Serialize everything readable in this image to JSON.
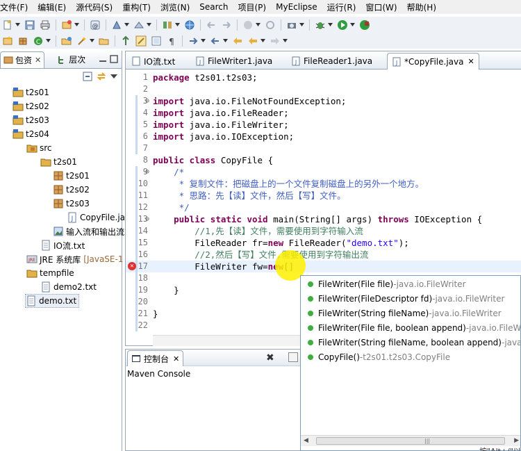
{
  "menu": [
    "文件(F)",
    "编辑(E)",
    "源代码(S)",
    "重构(T)",
    "浏览(N)",
    "Search",
    "项目(P)",
    "MyEclipse",
    "运行(R)",
    "窗口(W)",
    "帮助(H)"
  ],
  "left_panel": {
    "tabs": [
      {
        "label": "包资",
        "close": "✕"
      },
      {
        "label": "层次"
      }
    ],
    "tree": [
      {
        "label": "t2s01",
        "icon": "project-icon"
      },
      {
        "label": "t2s02",
        "icon": "project-icon"
      },
      {
        "label": "t2s03",
        "icon": "project-icon"
      },
      {
        "label": "t2s04",
        "icon": "project-icon"
      },
      {
        "label": "src",
        "icon": "source-folder-icon"
      },
      {
        "label": "t2s01",
        "icon": "package-icon"
      },
      {
        "label": "t2s01",
        "icon": "package-icon"
      },
      {
        "label": "t2s02",
        "icon": "package-icon"
      },
      {
        "label": "t2s03",
        "icon": "package-icon"
      },
      {
        "label": "CopyFile.ja",
        "icon": "java-file-icon"
      },
      {
        "label": "输入流和输出流",
        "icon": "image-file-icon"
      },
      {
        "label": "IO流.txt",
        "icon": "text-file-icon"
      },
      {
        "label": "JRE 系统库",
        "suffix": "[JavaSE-1",
        "icon": "library-icon"
      },
      {
        "label": "tempfile",
        "icon": "folder-icon"
      },
      {
        "label": "demo2.txt",
        "icon": "text-file-icon"
      },
      {
        "label": "demo.txt",
        "icon": "text-file-icon"
      }
    ]
  },
  "editor": {
    "tabs": [
      {
        "label": "IO流.txt",
        "icon": "text-file-icon"
      },
      {
        "label": "FileWriter1.java",
        "icon": "java-file-icon"
      },
      {
        "label": "FileReader1.java",
        "icon": "java-file-icon"
      },
      {
        "label": "*CopyFile.java",
        "icon": "java-file-icon",
        "close": "✕"
      }
    ],
    "lines": [
      {
        "n": "1",
        "parts": [
          [
            "kw",
            "package"
          ],
          [
            "",
            " t2s01.t2s03;"
          ]
        ]
      },
      {
        "n": "2",
        "parts": []
      },
      {
        "n": "3",
        "parts": [
          [
            "kw",
            "import"
          ],
          [
            "",
            " java.io.FileNotFoundException;"
          ]
        ]
      },
      {
        "n": "4",
        "parts": [
          [
            "kw",
            "import"
          ],
          [
            "",
            " java.io.FileReader;"
          ]
        ]
      },
      {
        "n": "5",
        "parts": [
          [
            "kw",
            "import"
          ],
          [
            "",
            " java.io.FileWriter;"
          ]
        ]
      },
      {
        "n": "6",
        "parts": [
          [
            "kw",
            "import"
          ],
          [
            "",
            " java.io.IOException;"
          ]
        ]
      },
      {
        "n": "7",
        "parts": []
      },
      {
        "n": "8",
        "parts": [
          [
            "kw",
            "public class"
          ],
          [
            "",
            " CopyFile {"
          ]
        ]
      },
      {
        "n": "9",
        "parts": [
          [
            "cm",
            "    /*"
          ]
        ]
      },
      {
        "n": "10",
        "parts": [
          [
            "cm",
            "     * 复制文件：把磁盘上的一个文件复制磁盘上的另外一个地方。"
          ]
        ]
      },
      {
        "n": "11",
        "parts": [
          [
            "cm",
            "     * 思路：先【读】文件，然后【写】文件。"
          ]
        ]
      },
      {
        "n": "12",
        "parts": [
          [
            "cm",
            "     */"
          ]
        ]
      },
      {
        "n": "13",
        "parts": [
          [
            "",
            "    "
          ],
          [
            "kw",
            "public static void"
          ],
          [
            "",
            " main(String[] args) "
          ],
          [
            "kw",
            "throws"
          ],
          [
            "",
            " IOException {"
          ]
        ]
      },
      {
        "n": "14",
        "parts": [
          [
            "cm2",
            "        //1,先【读】文件，需要使用到字符输入流"
          ]
        ]
      },
      {
        "n": "15",
        "parts": [
          [
            "",
            "        FileReader fr="
          ],
          [
            "kw",
            "new"
          ],
          [
            "",
            " FileReader("
          ],
          [
            "str",
            "\"demo.txt\""
          ],
          [
            "",
            ");"
          ]
        ]
      },
      {
        "n": "16",
        "parts": [
          [
            "cm2",
            "        //2,然后【写】文件,需要使用到字符输出流"
          ]
        ]
      },
      {
        "n": "17",
        "parts": [
          [
            "",
            "        FileWriter fw="
          ],
          [
            "kw",
            "new"
          ],
          [
            "",
            "[]"
          ]
        ]
      },
      {
        "n": "18",
        "parts": []
      },
      {
        "n": "19",
        "parts": [
          [
            "",
            "    }"
          ]
        ]
      },
      {
        "n": "20",
        "parts": []
      },
      {
        "n": "21",
        "parts": [
          [
            "",
            "}"
          ]
        ]
      },
      {
        "n": "22",
        "parts": []
      }
    ]
  },
  "console": {
    "tab_label": "控制台",
    "close": "✕",
    "title": "Maven Console"
  },
  "autocomplete": {
    "items": [
      {
        "name": "FileWriter(File file)",
        "qual": " -java.io.FileWriter"
      },
      {
        "name": "FileWriter(FileDescriptor fd)",
        "qual": " -java.io.FileWriter"
      },
      {
        "name": "FileWriter(String fileName)",
        "qual": " -java.io.FileWriter"
      },
      {
        "name": "FileWriter(File file, boolean append)",
        "qual": " -java.io.FileWr"
      },
      {
        "name": "FileWriter(String fileName, boolean append)",
        "qual": " -java."
      },
      {
        "name": "CopyFile()",
        "qual": " -t2s01.t2s03.CopyFile"
      }
    ],
    "hint": "按\"Alt+/\"以显示"
  },
  "colors": {
    "keyword": "#7f0055",
    "comment": "#3f5fbf",
    "line_comment": "#3f7f5f",
    "string": "#2a00ff",
    "highlight": "#fff000"
  }
}
